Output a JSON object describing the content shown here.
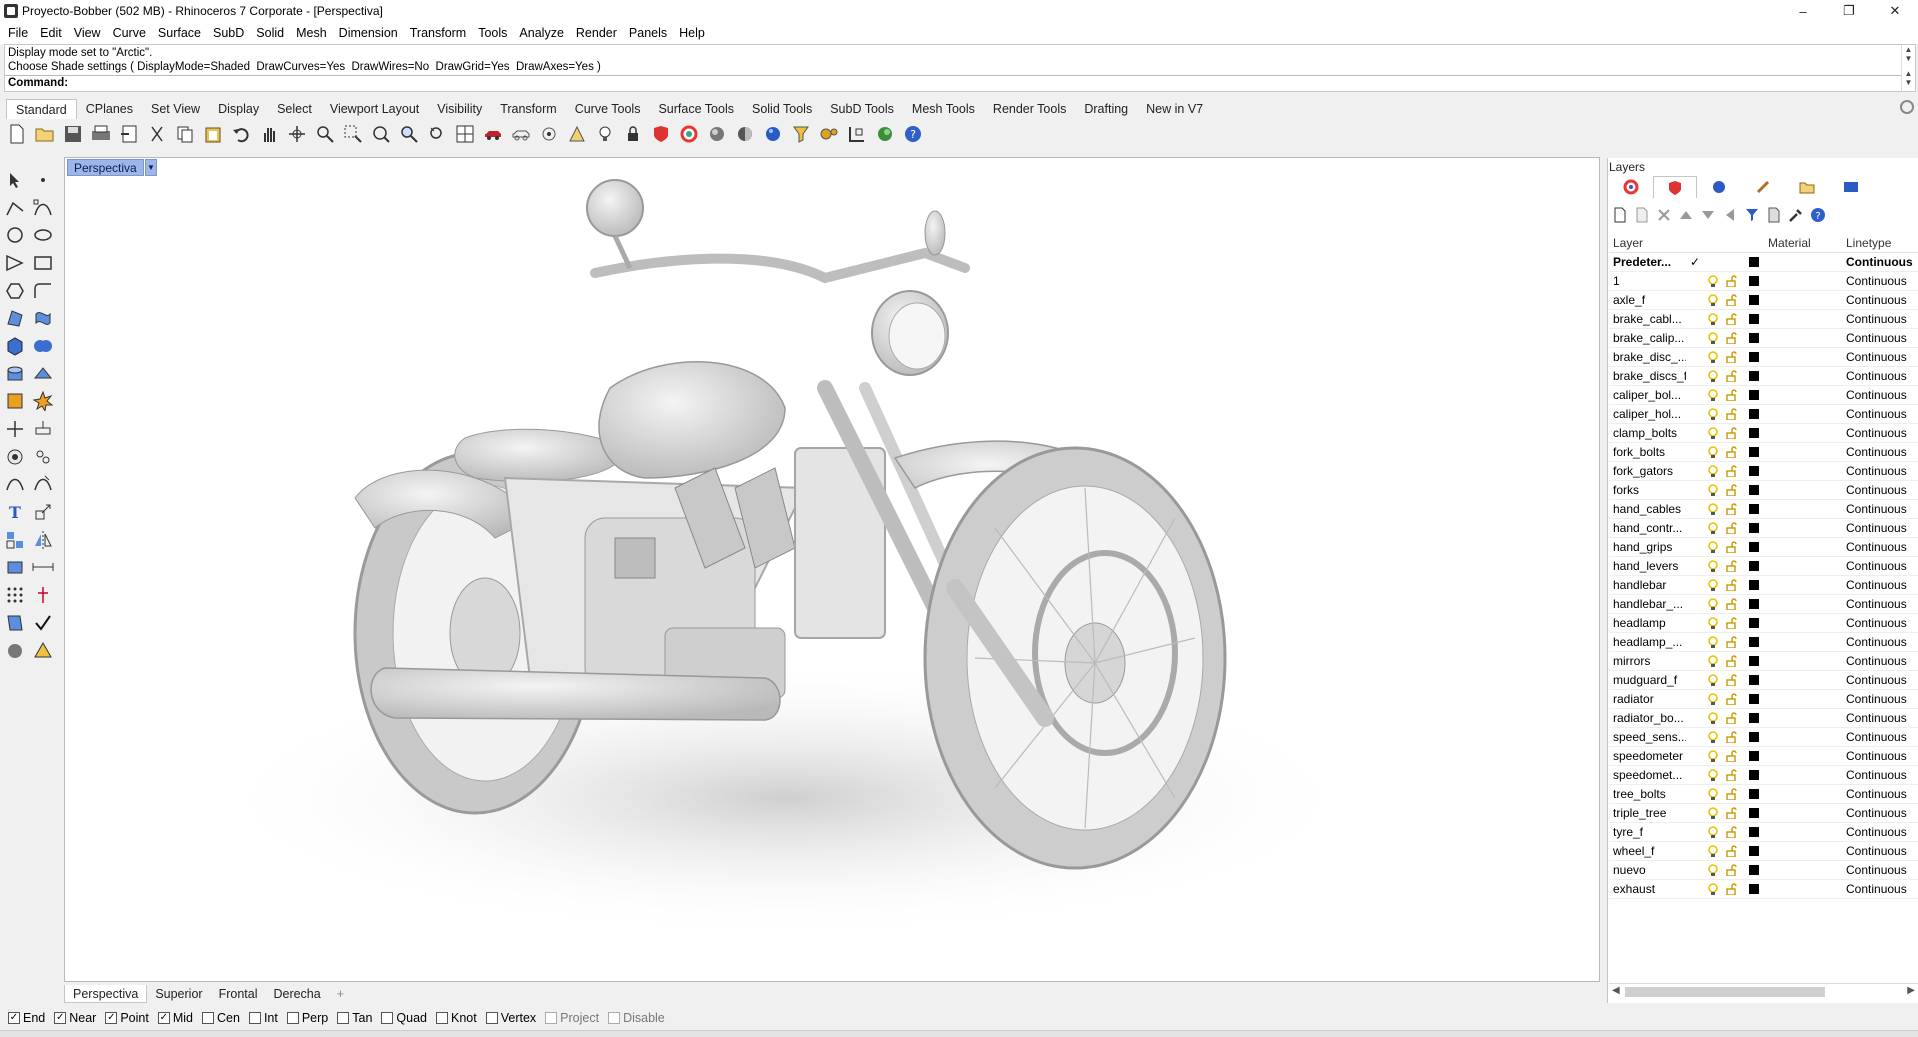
{
  "window": {
    "title": "Proyecto-Bobber (502 MB) - Rhinoceros 7 Corporate - [Perspectiva]",
    "minimize": "–",
    "restore": "❐",
    "close": "✕"
  },
  "menu": [
    "File",
    "Edit",
    "View",
    "Curve",
    "Surface",
    "SubD",
    "Solid",
    "Mesh",
    "Dimension",
    "Transform",
    "Tools",
    "Analyze",
    "Render",
    "Panels",
    "Help"
  ],
  "command": {
    "history": [
      "Display mode set to \"Arctic\".",
      "Choose Shade settings ( DisplayMode=Shaded  DrawCurves=Yes  DrawWires=No  DrawGrid=Yes  DrawAxes=Yes )"
    ],
    "prompt": "Command:"
  },
  "toolbar_tabs": [
    "Standard",
    "CPlanes",
    "Set View",
    "Display",
    "Select",
    "Viewport Layout",
    "Visibility",
    "Transform",
    "Curve Tools",
    "Surface Tools",
    "Solid Tools",
    "SubD Tools",
    "Mesh Tools",
    "Render Tools",
    "Drafting",
    "New in V7"
  ],
  "active_toolbar_tab": "Standard",
  "viewport": {
    "label": "Perspectiva",
    "display_mode": "Arctic"
  },
  "viewport_tabs": [
    "Perspectiva",
    "Superior",
    "Frontal",
    "Derecha"
  ],
  "viewport_add": "+",
  "layers_panel": {
    "title": "Layers",
    "columns": {
      "layer": "Layer",
      "material": "Material",
      "linetype": "Linetype"
    },
    "rows": [
      {
        "name": "Predeter...",
        "current": true,
        "linetype": "Continuous"
      },
      {
        "name": "1",
        "current": false,
        "linetype": "Continuous"
      },
      {
        "name": "axle_f",
        "current": false,
        "linetype": "Continuous"
      },
      {
        "name": "brake_cabl...",
        "current": false,
        "linetype": "Continuous"
      },
      {
        "name": "brake_calip...",
        "current": false,
        "linetype": "Continuous"
      },
      {
        "name": "brake_disc_...",
        "current": false,
        "linetype": "Continuous"
      },
      {
        "name": "brake_discs_f",
        "current": false,
        "linetype": "Continuous"
      },
      {
        "name": "caliper_bol...",
        "current": false,
        "linetype": "Continuous"
      },
      {
        "name": "caliper_hol...",
        "current": false,
        "linetype": "Continuous"
      },
      {
        "name": "clamp_bolts",
        "current": false,
        "linetype": "Continuous"
      },
      {
        "name": "fork_bolts",
        "current": false,
        "linetype": "Continuous"
      },
      {
        "name": "fork_gators",
        "current": false,
        "linetype": "Continuous"
      },
      {
        "name": "forks",
        "current": false,
        "linetype": "Continuous"
      },
      {
        "name": "hand_cables",
        "current": false,
        "linetype": "Continuous"
      },
      {
        "name": "hand_contr...",
        "current": false,
        "linetype": "Continuous"
      },
      {
        "name": "hand_grips",
        "current": false,
        "linetype": "Continuous"
      },
      {
        "name": "hand_levers",
        "current": false,
        "linetype": "Continuous"
      },
      {
        "name": "handlebar",
        "current": false,
        "linetype": "Continuous"
      },
      {
        "name": "handlebar_...",
        "current": false,
        "linetype": "Continuous"
      },
      {
        "name": "headlamp",
        "current": false,
        "linetype": "Continuous"
      },
      {
        "name": "headlamp_...",
        "current": false,
        "linetype": "Continuous"
      },
      {
        "name": "mirrors",
        "current": false,
        "linetype": "Continuous"
      },
      {
        "name": "mudguard_f",
        "current": false,
        "linetype": "Continuous"
      },
      {
        "name": "radiator",
        "current": false,
        "linetype": "Continuous"
      },
      {
        "name": "radiator_bo...",
        "current": false,
        "linetype": "Continuous"
      },
      {
        "name": "speed_sens...",
        "current": false,
        "linetype": "Continuous"
      },
      {
        "name": "speedometer",
        "current": false,
        "linetype": "Continuous"
      },
      {
        "name": "speedomet...",
        "current": false,
        "linetype": "Continuous"
      },
      {
        "name": "tree_bolts",
        "current": false,
        "linetype": "Continuous"
      },
      {
        "name": "triple_tree",
        "current": false,
        "linetype": "Continuous"
      },
      {
        "name": "tyre_f",
        "current": false,
        "linetype": "Continuous"
      },
      {
        "name": "wheel_f",
        "current": false,
        "linetype": "Continuous"
      },
      {
        "name": "nuevo",
        "current": false,
        "linetype": "Continuous"
      },
      {
        "name": "exhaust",
        "current": false,
        "linetype": "Continuous"
      }
    ]
  },
  "osnaps": [
    {
      "label": "End",
      "checked": true,
      "enabled": true
    },
    {
      "label": "Near",
      "checked": true,
      "enabled": true
    },
    {
      "label": "Point",
      "checked": true,
      "enabled": true
    },
    {
      "label": "Mid",
      "checked": true,
      "enabled": true
    },
    {
      "label": "Cen",
      "checked": false,
      "enabled": true
    },
    {
      "label": "Int",
      "checked": false,
      "enabled": true
    },
    {
      "label": "Perp",
      "checked": false,
      "enabled": true
    },
    {
      "label": "Tan",
      "checked": false,
      "enabled": true
    },
    {
      "label": "Quad",
      "checked": false,
      "enabled": true
    },
    {
      "label": "Knot",
      "checked": false,
      "enabled": true
    },
    {
      "label": "Vertex",
      "checked": false,
      "enabled": true
    },
    {
      "label": "Project",
      "checked": false,
      "enabled": false
    },
    {
      "label": "Disable",
      "checked": false,
      "enabled": false
    }
  ],
  "colors": {
    "viewport_label_bg": "#9db6e8",
    "layer_color": "#000000",
    "bulb": "#e8c400",
    "lock": "#c89a00"
  }
}
